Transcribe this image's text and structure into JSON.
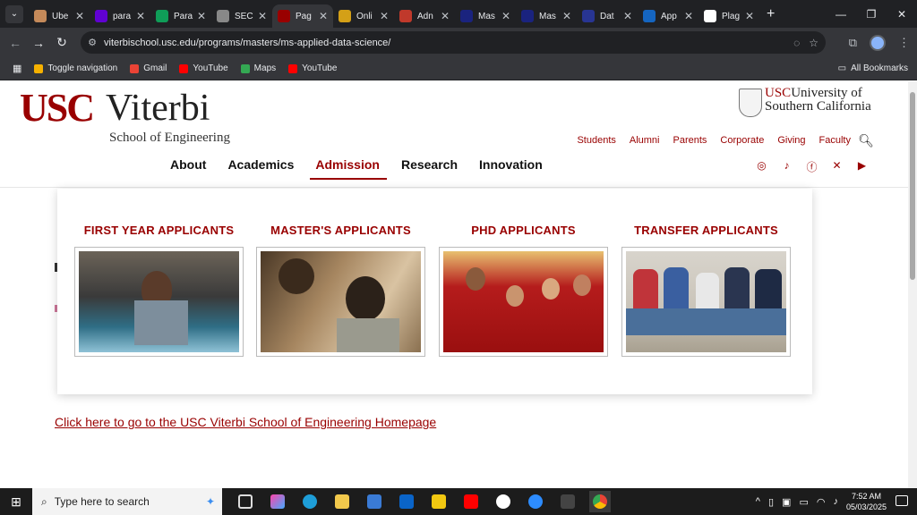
{
  "browser": {
    "tabs": [
      {
        "title": "Ube",
        "color": "#c58a5a"
      },
      {
        "title": "para",
        "color": "#6001d2"
      },
      {
        "title": "Para",
        "color": "#0f9d58"
      },
      {
        "title": "SEC",
        "color": "#888888"
      },
      {
        "title": "Pag",
        "color": "#990000",
        "active": true
      },
      {
        "title": "Onli",
        "color": "#d4a017"
      },
      {
        "title": "Adn",
        "color": "#c0392b"
      },
      {
        "title": "Mas",
        "color": "#1a237e"
      },
      {
        "title": "Mas",
        "color": "#1a237e"
      },
      {
        "title": "Dat",
        "color": "#283593"
      },
      {
        "title": "App",
        "color": "#1565c0"
      },
      {
        "title": "Plag",
        "color": "#ffffff"
      }
    ],
    "url": "viterbischool.usc.edu/programs/masters/ms-applied-data-science/",
    "bookmarks": [
      {
        "label": "Toggle navigation",
        "color": "#f6b100"
      },
      {
        "label": "Gmail",
        "color": "#ea4335"
      },
      {
        "label": "YouTube",
        "color": "#ff0000"
      },
      {
        "label": "Maps",
        "color": "#34a853"
      },
      {
        "label": "YouTube",
        "color": "#ff0000"
      }
    ],
    "all_bookmarks": "All Bookmarks"
  },
  "site": {
    "logo_usc": "USC",
    "logo_viterbi": "Viterbi",
    "logo_school": "School of Engineering",
    "usc_line1_red": "USC",
    "usc_line1": "University of",
    "usc_line2": "Southern California",
    "utility_links": [
      "Students",
      "Alumni",
      "Parents",
      "Corporate",
      "Giving",
      "Faculty"
    ],
    "main_nav": [
      "About",
      "Academics",
      "Admission",
      "Research",
      "Innovation"
    ],
    "active_nav": "Admission",
    "social": [
      "instagram-icon",
      "tiktok-icon",
      "facebook-icon",
      "x-icon",
      "youtube-icon"
    ],
    "homepage_link": "Click here to go to the USC Viterbi School of Engineering Homepage"
  },
  "dropdown": {
    "applicants": [
      {
        "label": "FIRST YEAR APPLICANTS"
      },
      {
        "label": "MASTER'S APPLICANTS"
      },
      {
        "label": "PHD APPLICANTS"
      },
      {
        "label": "TRANSFER APPLICANTS"
      }
    ]
  },
  "taskbar": {
    "search_placeholder": "Type here to search",
    "time": "7:52 AM",
    "date": "05/03/2025"
  }
}
